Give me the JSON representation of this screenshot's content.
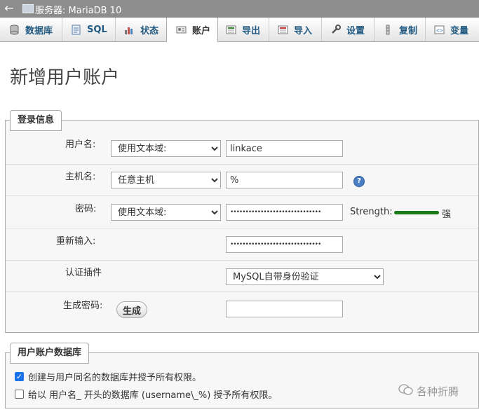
{
  "titlebar": {
    "back": "←",
    "server": "服务器: MariaDB 10"
  },
  "tabs": [
    {
      "label": "数据库",
      "icon": "database-icon"
    },
    {
      "label": "SQL",
      "icon": "sql-icon"
    },
    {
      "label": "状态",
      "icon": "status-icon"
    },
    {
      "label": "账户",
      "icon": "accounts-icon",
      "active": true
    },
    {
      "label": "导出",
      "icon": "export-icon"
    },
    {
      "label": "导入",
      "icon": "import-icon"
    },
    {
      "label": "设置",
      "icon": "settings-icon"
    },
    {
      "label": "复制",
      "icon": "replication-icon"
    },
    {
      "label": "变量",
      "icon": "variables-icon"
    }
  ],
  "page_title": "新增用户账户",
  "login": {
    "legend": "登录信息",
    "username_label": "用户名:",
    "username_mode": "使用文本域:",
    "username_value": "linkace",
    "host_label": "主机名:",
    "host_mode": "任意主机",
    "host_value": "%",
    "password_label": "密码:",
    "password_mode": "使用文本域:",
    "password_value": "••••••••••••••••••••••••••••••",
    "strength_label": "Strength:",
    "strength_text": "强",
    "reenter_label": "重新输入:",
    "reenter_value": "••••••••••••••••••••••••••••••",
    "auth_label": "认证插件",
    "auth_value": "MySQL自带身份验证",
    "generate_label": "生成密码:",
    "generate_button": "生成",
    "generated_value": ""
  },
  "userdb": {
    "legend": "用户账户数据库",
    "option1": "创建与用户同名的数据库并授予所有权限。",
    "option1_checked": true,
    "option2": "给以 用户名_ 开头的数据库 (username\\_%) 授予所有权限。",
    "option2_checked": false
  },
  "watermark": "各种折腾",
  "colors": {
    "tab_link": "#235a81",
    "strength_bar": "#1a7a1a",
    "checkbox": "#1a73e8"
  }
}
